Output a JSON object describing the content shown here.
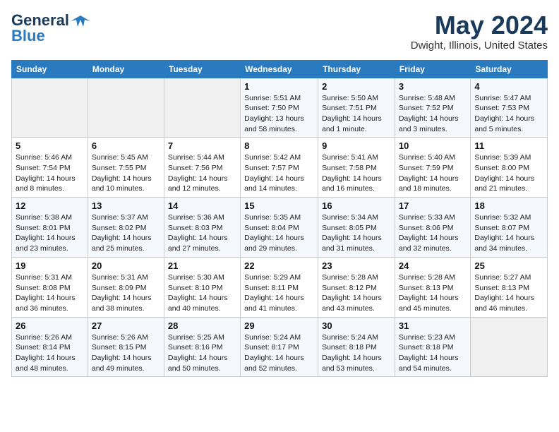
{
  "header": {
    "logo_line1": "General",
    "logo_line2": "Blue",
    "month_title": "May 2024",
    "location": "Dwight, Illinois, United States"
  },
  "weekdays": [
    "Sunday",
    "Monday",
    "Tuesday",
    "Wednesday",
    "Thursday",
    "Friday",
    "Saturday"
  ],
  "weeks": [
    [
      {
        "day": "",
        "info": ""
      },
      {
        "day": "",
        "info": ""
      },
      {
        "day": "",
        "info": ""
      },
      {
        "day": "1",
        "info": "Sunrise: 5:51 AM\nSunset: 7:50 PM\nDaylight: 13 hours\nand 58 minutes."
      },
      {
        "day": "2",
        "info": "Sunrise: 5:50 AM\nSunset: 7:51 PM\nDaylight: 14 hours\nand 1 minute."
      },
      {
        "day": "3",
        "info": "Sunrise: 5:48 AM\nSunset: 7:52 PM\nDaylight: 14 hours\nand 3 minutes."
      },
      {
        "day": "4",
        "info": "Sunrise: 5:47 AM\nSunset: 7:53 PM\nDaylight: 14 hours\nand 5 minutes."
      }
    ],
    [
      {
        "day": "5",
        "info": "Sunrise: 5:46 AM\nSunset: 7:54 PM\nDaylight: 14 hours\nand 8 minutes."
      },
      {
        "day": "6",
        "info": "Sunrise: 5:45 AM\nSunset: 7:55 PM\nDaylight: 14 hours\nand 10 minutes."
      },
      {
        "day": "7",
        "info": "Sunrise: 5:44 AM\nSunset: 7:56 PM\nDaylight: 14 hours\nand 12 minutes."
      },
      {
        "day": "8",
        "info": "Sunrise: 5:42 AM\nSunset: 7:57 PM\nDaylight: 14 hours\nand 14 minutes."
      },
      {
        "day": "9",
        "info": "Sunrise: 5:41 AM\nSunset: 7:58 PM\nDaylight: 14 hours\nand 16 minutes."
      },
      {
        "day": "10",
        "info": "Sunrise: 5:40 AM\nSunset: 7:59 PM\nDaylight: 14 hours\nand 18 minutes."
      },
      {
        "day": "11",
        "info": "Sunrise: 5:39 AM\nSunset: 8:00 PM\nDaylight: 14 hours\nand 21 minutes."
      }
    ],
    [
      {
        "day": "12",
        "info": "Sunrise: 5:38 AM\nSunset: 8:01 PM\nDaylight: 14 hours\nand 23 minutes."
      },
      {
        "day": "13",
        "info": "Sunrise: 5:37 AM\nSunset: 8:02 PM\nDaylight: 14 hours\nand 25 minutes."
      },
      {
        "day": "14",
        "info": "Sunrise: 5:36 AM\nSunset: 8:03 PM\nDaylight: 14 hours\nand 27 minutes."
      },
      {
        "day": "15",
        "info": "Sunrise: 5:35 AM\nSunset: 8:04 PM\nDaylight: 14 hours\nand 29 minutes."
      },
      {
        "day": "16",
        "info": "Sunrise: 5:34 AM\nSunset: 8:05 PM\nDaylight: 14 hours\nand 31 minutes."
      },
      {
        "day": "17",
        "info": "Sunrise: 5:33 AM\nSunset: 8:06 PM\nDaylight: 14 hours\nand 32 minutes."
      },
      {
        "day": "18",
        "info": "Sunrise: 5:32 AM\nSunset: 8:07 PM\nDaylight: 14 hours\nand 34 minutes."
      }
    ],
    [
      {
        "day": "19",
        "info": "Sunrise: 5:31 AM\nSunset: 8:08 PM\nDaylight: 14 hours\nand 36 minutes."
      },
      {
        "day": "20",
        "info": "Sunrise: 5:31 AM\nSunset: 8:09 PM\nDaylight: 14 hours\nand 38 minutes."
      },
      {
        "day": "21",
        "info": "Sunrise: 5:30 AM\nSunset: 8:10 PM\nDaylight: 14 hours\nand 40 minutes."
      },
      {
        "day": "22",
        "info": "Sunrise: 5:29 AM\nSunset: 8:11 PM\nDaylight: 14 hours\nand 41 minutes."
      },
      {
        "day": "23",
        "info": "Sunrise: 5:28 AM\nSunset: 8:12 PM\nDaylight: 14 hours\nand 43 minutes."
      },
      {
        "day": "24",
        "info": "Sunrise: 5:28 AM\nSunset: 8:13 PM\nDaylight: 14 hours\nand 45 minutes."
      },
      {
        "day": "25",
        "info": "Sunrise: 5:27 AM\nSunset: 8:13 PM\nDaylight: 14 hours\nand 46 minutes."
      }
    ],
    [
      {
        "day": "26",
        "info": "Sunrise: 5:26 AM\nSunset: 8:14 PM\nDaylight: 14 hours\nand 48 minutes."
      },
      {
        "day": "27",
        "info": "Sunrise: 5:26 AM\nSunset: 8:15 PM\nDaylight: 14 hours\nand 49 minutes."
      },
      {
        "day": "28",
        "info": "Sunrise: 5:25 AM\nSunset: 8:16 PM\nDaylight: 14 hours\nand 50 minutes."
      },
      {
        "day": "29",
        "info": "Sunrise: 5:24 AM\nSunset: 8:17 PM\nDaylight: 14 hours\nand 52 minutes."
      },
      {
        "day": "30",
        "info": "Sunrise: 5:24 AM\nSunset: 8:18 PM\nDaylight: 14 hours\nand 53 minutes."
      },
      {
        "day": "31",
        "info": "Sunrise: 5:23 AM\nSunset: 8:18 PM\nDaylight: 14 hours\nand 54 minutes."
      },
      {
        "day": "",
        "info": ""
      }
    ]
  ]
}
